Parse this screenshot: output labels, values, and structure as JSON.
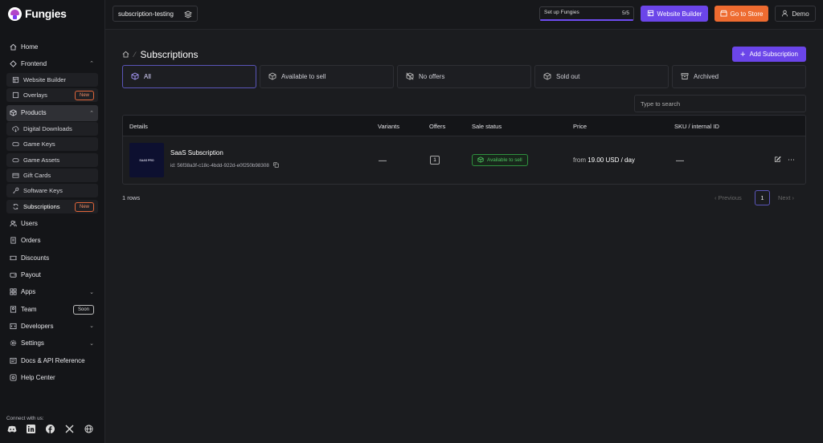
{
  "brand": {
    "name": "Fungies"
  },
  "topbar": {
    "project": "subscription-testing",
    "setup_label": "Set up Fungies",
    "setup_count": "5/5",
    "website_builder": "Website Builder",
    "go_to_store": "Go to Store",
    "user": "Demo"
  },
  "sidebar": {
    "home": "Home",
    "frontend": "Frontend",
    "website_builder": "Website Builder",
    "overlays": "Overlays",
    "overlays_badge": "New",
    "products": "Products",
    "product_items": [
      {
        "label": "Digital Downloads"
      },
      {
        "label": "Game Keys"
      },
      {
        "label": "Game Assets"
      },
      {
        "label": "Gift Cards"
      },
      {
        "label": "Software Keys"
      },
      {
        "label": "Subscriptions",
        "badge": "New"
      }
    ],
    "users": "Users",
    "orders": "Orders",
    "discounts": "Discounts",
    "payout": "Payout",
    "apps": "Apps",
    "team": "Team",
    "team_badge": "Soon",
    "developers": "Developers",
    "settings": "Settings",
    "docs": "Docs & API Reference",
    "help": "Help Center",
    "connect": "Connect with us:"
  },
  "main": {
    "title": "Subscriptions",
    "add_button": "Add Subscription",
    "tabs": [
      {
        "label": "All"
      },
      {
        "label": "Available to sell"
      },
      {
        "label": "No offers"
      },
      {
        "label": "Sold out"
      },
      {
        "label": "Archived"
      }
    ],
    "search_placeholder": "Type to search",
    "columns": {
      "details": "Details",
      "variants": "Variants",
      "offers": "Offers",
      "sale_status": "Sale status",
      "price": "Price",
      "sku": "SKU / internal ID"
    },
    "row": {
      "thumb_text": "SAAS PRO",
      "name": "SaaS Subscription",
      "id": "id: 56f38a3f-c18c-4bdd-922d-e0f250b98308",
      "variants": "—",
      "offers": "1",
      "status": "Available to sell",
      "price_prefix": "from",
      "price": "19.00 USD / day",
      "sku": "—"
    },
    "row_count": "1 rows",
    "pager": {
      "previous": "Previous",
      "page": "1",
      "next": "Next"
    }
  },
  "colors": {
    "accent": "#6b45e9",
    "store": "#ee6b30",
    "success": "#4cc25e",
    "badge_new": "#e0653a"
  }
}
